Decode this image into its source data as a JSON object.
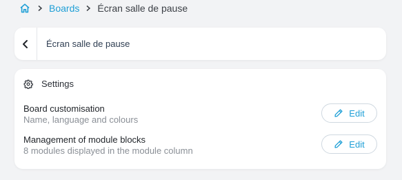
{
  "breadcrumb": {
    "home_icon": "home-icon",
    "separator_icon": "chevron-right-icon",
    "items": [
      {
        "label": "Boards"
      },
      {
        "label": "Écran salle de pause"
      }
    ]
  },
  "header": {
    "back_icon": "chevron-left-icon",
    "title": "Écran salle de pause"
  },
  "settings": {
    "icon": "gear-icon",
    "title": "Settings",
    "rows": [
      {
        "title": "Board customisation",
        "subtitle": "Name, language and colours",
        "button_label": "Edit",
        "button_icon": "pencil-icon"
      },
      {
        "title": "Management of module blocks",
        "subtitle": "8 modules displayed in the module column",
        "button_label": "Edit",
        "button_icon": "pencil-icon"
      }
    ]
  },
  "colors": {
    "accent": "#1e9fd6",
    "background": "#f2f3f5",
    "card": "#ffffff",
    "muted_text": "#8a8f96"
  }
}
